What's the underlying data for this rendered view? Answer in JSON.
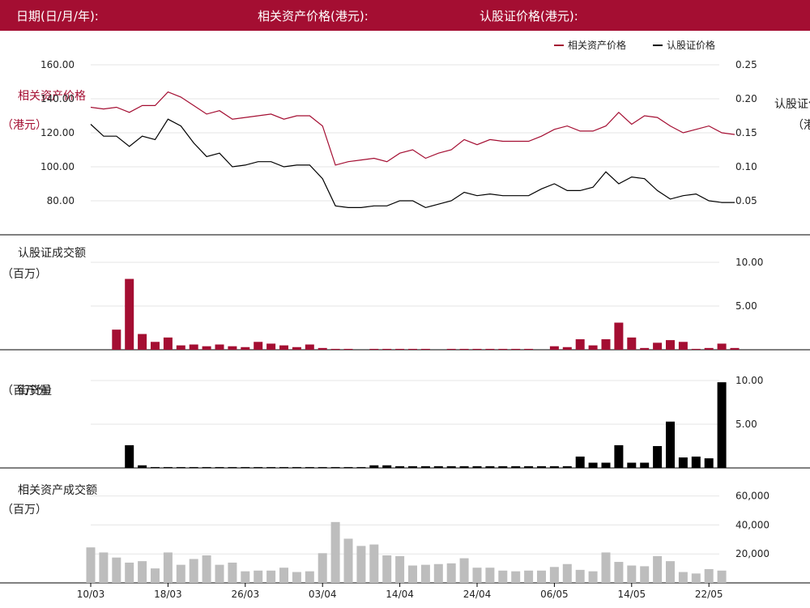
{
  "header": {
    "date_label": "日期(日/月/年):",
    "underlying_label": "相关资产价格(港元):",
    "warrant_label": "认股证价格(港元):"
  },
  "axis_titles": {
    "price_left": [
      "相关资产价格",
      "（港元）"
    ],
    "price_right": [
      "认股证价格",
      "（港元）"
    ],
    "warrant_turnover": [
      "认股证成交额",
      "（百万）"
    ],
    "outstanding": [
      "街货量",
      "（百万份）"
    ],
    "underlying_turnover": [
      "相关资产成交额",
      "（百万）"
    ]
  },
  "colors": {
    "underlying": "#a40e32",
    "warrant": "#000000",
    "turnover": "#bdbdbd",
    "header_bg": "#a40e32"
  },
  "chart_data": [
    {
      "type": "line",
      "name": "price",
      "legend": [
        "相关资产价格",
        "认股证价格"
      ],
      "legend_position": "top-right",
      "grid": true,
      "y_left_ticks": [
        "80.00",
        "100.00",
        "120.00",
        "140.00",
        "160.00"
      ],
      "y_left_lim": [
        60,
        160
      ],
      "y_right_ticks": [
        "0.05",
        "0.10",
        "0.15",
        "0.20",
        "0.25"
      ],
      "y_right_lim": [
        0.025,
        0.25
      ],
      "series": [
        {
          "name": "相关资产价格",
          "axis": "left",
          "values": [
            135,
            134,
            135,
            132,
            136,
            136,
            144,
            141,
            136,
            131,
            133,
            128,
            129,
            130,
            131,
            128,
            130,
            130,
            124,
            101,
            103,
            104,
            105,
            103,
            108,
            110,
            105,
            108,
            110,
            116,
            113,
            116,
            115,
            115,
            115,
            118,
            122,
            124,
            121,
            121,
            124,
            132,
            125,
            130,
            129,
            124,
            120,
            122,
            124,
            120,
            119
          ]
        },
        {
          "name": "认股证价格",
          "axis": "left",
          "values": [
            125,
            118,
            118,
            112,
            118,
            116,
            128,
            124,
            114,
            106,
            108,
            100,
            101,
            103,
            103,
            100,
            101,
            101,
            93,
            77,
            76,
            76,
            77,
            77,
            80,
            80,
            76,
            78,
            80,
            85,
            83,
            84,
            83,
            83,
            83,
            87,
            90,
            86,
            86,
            88,
            97,
            90,
            94,
            93,
            86,
            81,
            83,
            84,
            80,
            79,
            79
          ]
        }
      ]
    },
    {
      "type": "bar",
      "name": "warrant_turnover",
      "y_ticks": [
        "5.00",
        "10.00"
      ],
      "ylim": [
        0,
        12
      ],
      "values": [
        0,
        0,
        2.3,
        8.1,
        1.8,
        0.9,
        1.4,
        0.5,
        0.6,
        0.4,
        0.6,
        0.4,
        0.3,
        0.9,
        0.7,
        0.5,
        0.3,
        0.6,
        0.2,
        0.1,
        0.1,
        0,
        0.1,
        0.1,
        0.1,
        0.1,
        0.1,
        0,
        0.1,
        0.1,
        0.1,
        0.1,
        0.1,
        0.1,
        0.1,
        0,
        0.4,
        0.3,
        1.2,
        0.5,
        1.2,
        3.1,
        1.4,
        0.2,
        0.8,
        1.1,
        0.9,
        0.1,
        0.2,
        0.7,
        0.2
      ]
    },
    {
      "type": "bar",
      "name": "outstanding",
      "y_ticks": [
        "5.00",
        "10.00"
      ],
      "ylim": [
        0,
        12
      ],
      "values": [
        0,
        0,
        0,
        2.6,
        0.3,
        0.1,
        0.1,
        0.1,
        0.1,
        0.1,
        0.1,
        0.1,
        0.1,
        0.1,
        0.1,
        0.1,
        0.1,
        0.1,
        0.1,
        0.1,
        0.1,
        0.1,
        0.3,
        0.3,
        0.2,
        0.2,
        0.2,
        0.2,
        0.2,
        0.2,
        0.2,
        0.2,
        0.2,
        0.2,
        0.2,
        0.2,
        0.2,
        0.2,
        1.3,
        0.6,
        0.6,
        2.6,
        0.6,
        0.6,
        2.5,
        5.3,
        1.2,
        1.3,
        1.1,
        9.8,
        0
      ]
    },
    {
      "type": "bar",
      "name": "underlying_turnover",
      "y_ticks": [
        "20,000",
        "40,000",
        "60,000"
      ],
      "ylim": [
        0,
        60000
      ],
      "values": [
        24500,
        21000,
        17500,
        14000,
        15000,
        10000,
        21000,
        12500,
        16500,
        19000,
        12500,
        14000,
        8000,
        8500,
        8500,
        10500,
        7500,
        8000,
        20500,
        42000,
        30500,
        25500,
        26500,
        19000,
        18500,
        12000,
        12500,
        13000,
        13500,
        17000,
        10500,
        10500,
        8500,
        8000,
        8500,
        8500,
        11000,
        13000,
        9000,
        8000,
        21000,
        14500,
        12000,
        11500,
        18500,
        15000,
        7500,
        6500,
        9500,
        8500,
        0
      ]
    }
  ],
  "x_ticks": [
    "10/03",
    "18/03",
    "26/03",
    "03/04",
    "14/04",
    "24/04",
    "06/05",
    "14/05",
    "22/05"
  ],
  "x_tick_index": [
    0,
    6,
    12,
    18,
    24,
    30,
    36,
    42,
    48
  ]
}
